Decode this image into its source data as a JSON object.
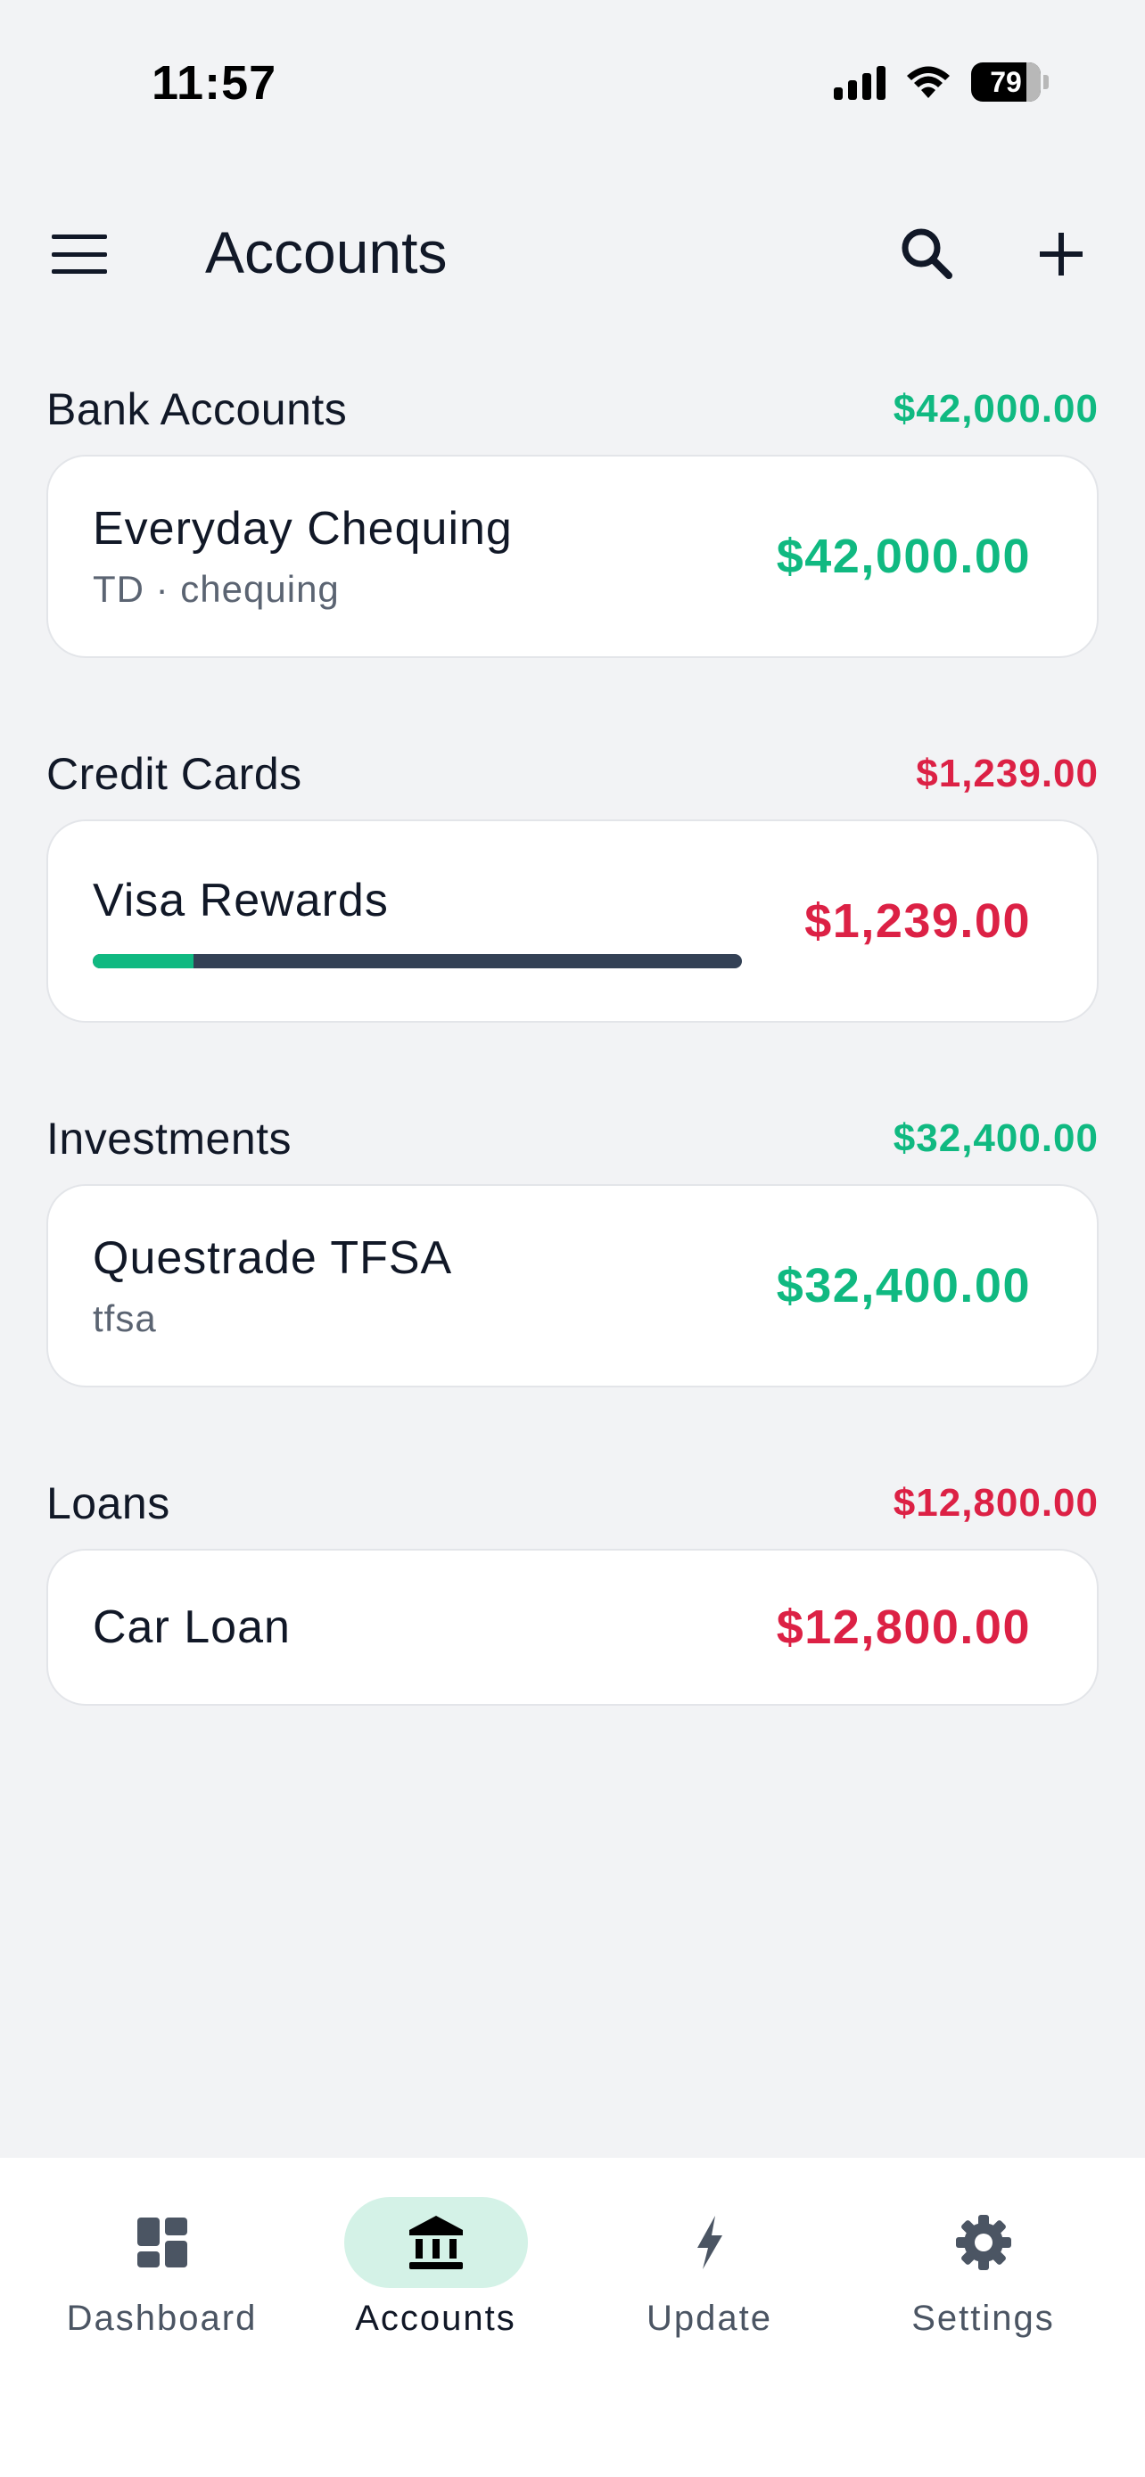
{
  "status_bar": {
    "time": "11:57",
    "battery": "79"
  },
  "header": {
    "title": "Accounts"
  },
  "sections": [
    {
      "title": "Bank Accounts",
      "total": "$42,000.00",
      "accounts": [
        {
          "name": "Everyday Chequing",
          "subtitle": "TD · chequing",
          "amount": "$42,000.00"
        }
      ]
    },
    {
      "title": "Credit Cards",
      "total": "$1,239.00",
      "accounts": [
        {
          "name": "Visa Rewards",
          "amount": "$1,239.00",
          "utilization_fraction": 0.155
        }
      ]
    },
    {
      "title": "Investments",
      "total": "$32,400.00",
      "accounts": [
        {
          "name": "Questrade TFSA",
          "subtitle": "tfsa",
          "amount": "$32,400.00"
        }
      ]
    },
    {
      "title": "Loans",
      "total": "$12,800.00",
      "accounts": [
        {
          "name": "Car Loan",
          "amount": "$12,800.00"
        }
      ]
    }
  ],
  "colors": {
    "positive": "#10b981",
    "negative": "#dc2145",
    "active_nav_bg": "#d4f2e7"
  },
  "bottom_nav": [
    {
      "label": "Dashboard",
      "icon": "dashboard-icon"
    },
    {
      "label": "Accounts",
      "icon": "bank-icon",
      "active": true
    },
    {
      "label": "Update",
      "icon": "bolt-icon"
    },
    {
      "label": "Settings",
      "icon": "gear-icon"
    }
  ]
}
